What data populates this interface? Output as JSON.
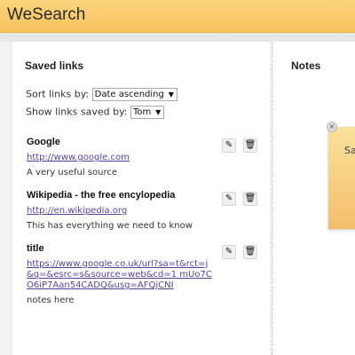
{
  "app": {
    "title": "WeSearch"
  },
  "saved_links": {
    "heading": "Saved links",
    "sort_label": "Sort links by:",
    "sort_value": "Date ascending",
    "show_label": "Show links saved by:",
    "show_value": "Tom",
    "items": [
      {
        "title": "Google",
        "url": "http://www.google.com",
        "description": "A very useful source"
      },
      {
        "title": "Wikipedia - the free encylopedia",
        "url": "http://en.wikipedia.org",
        "description": "This has everything we need to know"
      },
      {
        "title": "title",
        "url": "https://www.google.co.uk/url?sa=t&rct=j&q=&esrc=s&source=web&cd=1 mUo7CO6iP7Aan54CADQ&usg=AFQjCNI",
        "description": "notes here"
      }
    ]
  },
  "notes": {
    "heading": "Notes",
    "note_preview": "Sa"
  },
  "icons": {
    "edit": "pencil-icon",
    "delete": "trash-icon",
    "close": "close-icon",
    "dropdown": "chevron-down-icon"
  }
}
